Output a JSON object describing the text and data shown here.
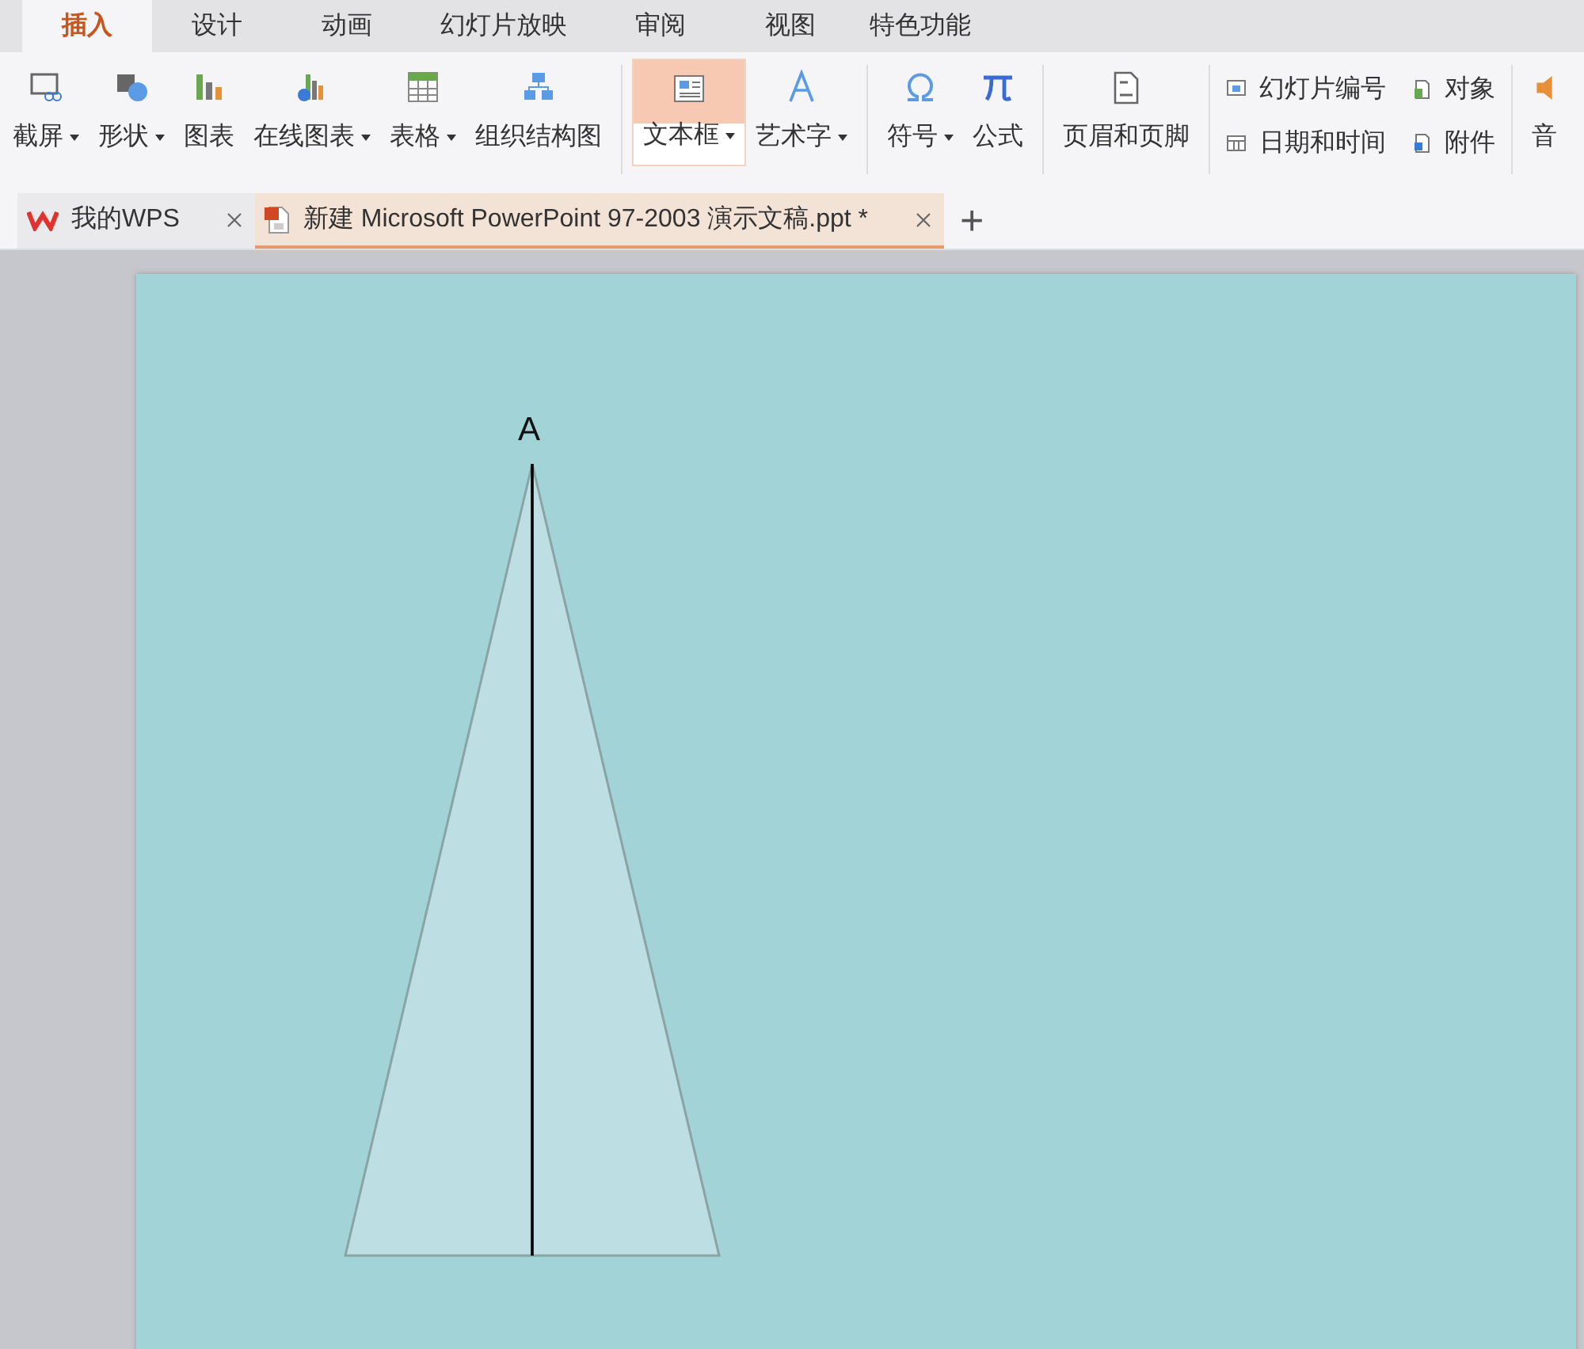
{
  "ribbon_tabs": [
    {
      "label": "插入",
      "selected": true
    },
    {
      "label": "设计",
      "selected": false
    },
    {
      "label": "动画",
      "selected": false
    },
    {
      "label": "幻灯片放映",
      "selected": false
    },
    {
      "label": "审阅",
      "selected": false
    },
    {
      "label": "视图",
      "selected": false
    },
    {
      "label": "特色功能",
      "selected": false
    }
  ],
  "toolbar": {
    "groups": [
      {
        "kind": "large",
        "items": [
          {
            "label": "截屏",
            "dropdown": true,
            "selected": false
          },
          {
            "label": "形状",
            "dropdown": true,
            "selected": false
          },
          {
            "label": "图表",
            "dropdown": false,
            "selected": false
          },
          {
            "label": "在线图表",
            "dropdown": true,
            "selected": false
          },
          {
            "label": "表格",
            "dropdown": true,
            "selected": false
          },
          {
            "label": "组织结构图",
            "dropdown": false,
            "selected": false
          }
        ]
      },
      {
        "kind": "large",
        "items": [
          {
            "label": "文本框",
            "dropdown": true,
            "selected": true
          },
          {
            "label": "艺术字",
            "dropdown": true,
            "selected": false
          }
        ]
      },
      {
        "kind": "large",
        "items": [
          {
            "label": "符号",
            "dropdown": true,
            "selected": false
          },
          {
            "label": "公式",
            "dropdown": false,
            "selected": false
          }
        ]
      },
      {
        "kind": "large",
        "items": [
          {
            "label": "页眉和页脚",
            "dropdown": false,
            "selected": false
          }
        ]
      },
      {
        "kind": "small",
        "items": [
          {
            "label": "幻灯片编号"
          },
          {
            "label": "日期和时间"
          },
          {
            "label": "对象"
          },
          {
            "label": "附件"
          }
        ]
      },
      {
        "kind": "large",
        "items": [
          {
            "label": "音",
            "selected": false
          }
        ]
      }
    ]
  },
  "document_tabs": [
    {
      "label": "我的WPS",
      "selected": false,
      "closable": true
    },
    {
      "label": "新建 Microsoft PowerPoint 97-2003 演示文稿.ppt *",
      "selected": true,
      "closable": true
    }
  ],
  "new_tab_button": "+",
  "slide": {
    "vertex_label": "A"
  }
}
